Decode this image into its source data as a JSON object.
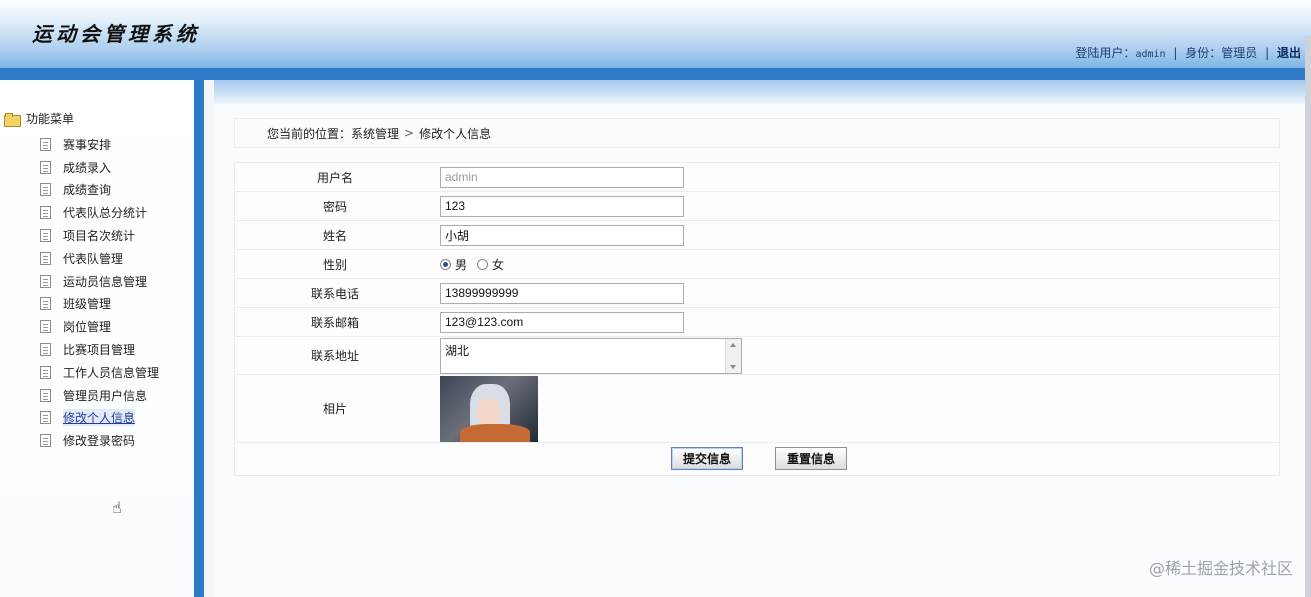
{
  "header": {
    "title": "运动会管理系统",
    "user_label": "登陆用户：",
    "user_name": "admin",
    "role_label": "身份：",
    "role": "管理员",
    "separator": "|",
    "logout": "退出"
  },
  "sidebar": {
    "root_label": "功能菜单",
    "items": [
      {
        "label": "赛事安排"
      },
      {
        "label": "成绩录入"
      },
      {
        "label": "成绩查询"
      },
      {
        "label": "代表队总分统计"
      },
      {
        "label": "项目名次统计"
      },
      {
        "label": "代表队管理"
      },
      {
        "label": "运动员信息管理"
      },
      {
        "label": "班级管理"
      },
      {
        "label": "岗位管理"
      },
      {
        "label": "比赛项目管理"
      },
      {
        "label": "工作人员信息管理"
      },
      {
        "label": "管理员用户信息"
      },
      {
        "label": "修改个人信息"
      },
      {
        "label": "修改登录密码"
      }
    ]
  },
  "breadcrumb": {
    "prefix": "您当前的位置：",
    "section": "系统管理",
    "separator": ">",
    "current": "修改个人信息"
  },
  "form": {
    "username": {
      "label": "用户名",
      "value": "admin"
    },
    "password": {
      "label": "密码",
      "value": "123"
    },
    "name": {
      "label": "姓名",
      "value": "小胡"
    },
    "gender": {
      "label": "性别",
      "option_male": "男",
      "option_female": "女",
      "selected": "男"
    },
    "phone": {
      "label": "联系电话",
      "value": "13899999999"
    },
    "email": {
      "label": "联系邮箱",
      "value": "123@123.com"
    },
    "address": {
      "label": "联系地址",
      "value": "湖北"
    },
    "photo": {
      "label": "相片"
    },
    "submit_label": "提交信息",
    "reset_label": "重置信息"
  },
  "watermark": "@稀土掘金技术社区"
}
